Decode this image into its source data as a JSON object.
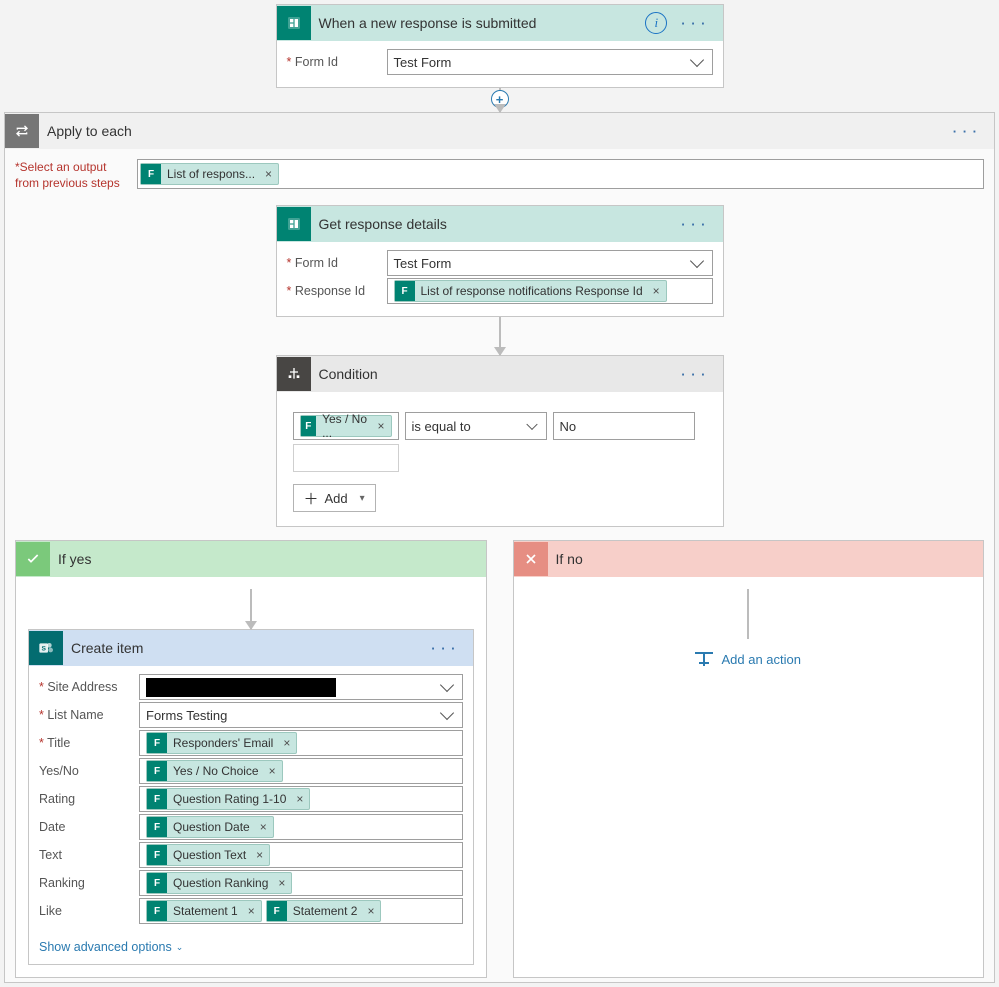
{
  "trigger": {
    "title": "When a new response is submitted",
    "formId_label": "Form Id",
    "formId_value": "Test Form"
  },
  "applyToEach": {
    "title": "Apply to each",
    "select_label": "Select an output from previous steps",
    "select_token": "List of respons..."
  },
  "getDetails": {
    "title": "Get response details",
    "formId_label": "Form Id",
    "formId_value": "Test Form",
    "responseId_label": "Response Id",
    "responseId_token": "List of response notifications Response Id"
  },
  "condition": {
    "title": "Condition",
    "left_token": "Yes / No ...",
    "operator": "is equal to",
    "right_value": "No",
    "add_label": "Add"
  },
  "branches": {
    "yes_title": "If yes",
    "no_title": "If no",
    "add_action": "Add an action"
  },
  "createItem": {
    "title": "Create item",
    "advanced": "Show advanced options",
    "rows": [
      {
        "label": "Site Address",
        "required": true,
        "type": "select-redacted"
      },
      {
        "label": "List Name",
        "required": true,
        "type": "select",
        "value": "Forms Testing"
      },
      {
        "label": "Title",
        "required": true,
        "type": "tokens",
        "tokens": [
          "Responders' Email"
        ]
      },
      {
        "label": "Yes/No",
        "required": false,
        "type": "tokens",
        "tokens": [
          "Yes / No Choice"
        ]
      },
      {
        "label": "Rating",
        "required": false,
        "type": "tokens",
        "tokens": [
          "Question Rating 1-10"
        ]
      },
      {
        "label": "Date",
        "required": false,
        "type": "tokens",
        "tokens": [
          "Question Date"
        ]
      },
      {
        "label": "Text",
        "required": false,
        "type": "tokens",
        "tokens": [
          "Question Text"
        ]
      },
      {
        "label": "Ranking",
        "required": false,
        "type": "tokens",
        "tokens": [
          "Question Ranking"
        ]
      },
      {
        "label": "Like",
        "required": false,
        "type": "tokens",
        "tokens": [
          "Statement 1",
          "Statement 2"
        ]
      }
    ]
  }
}
